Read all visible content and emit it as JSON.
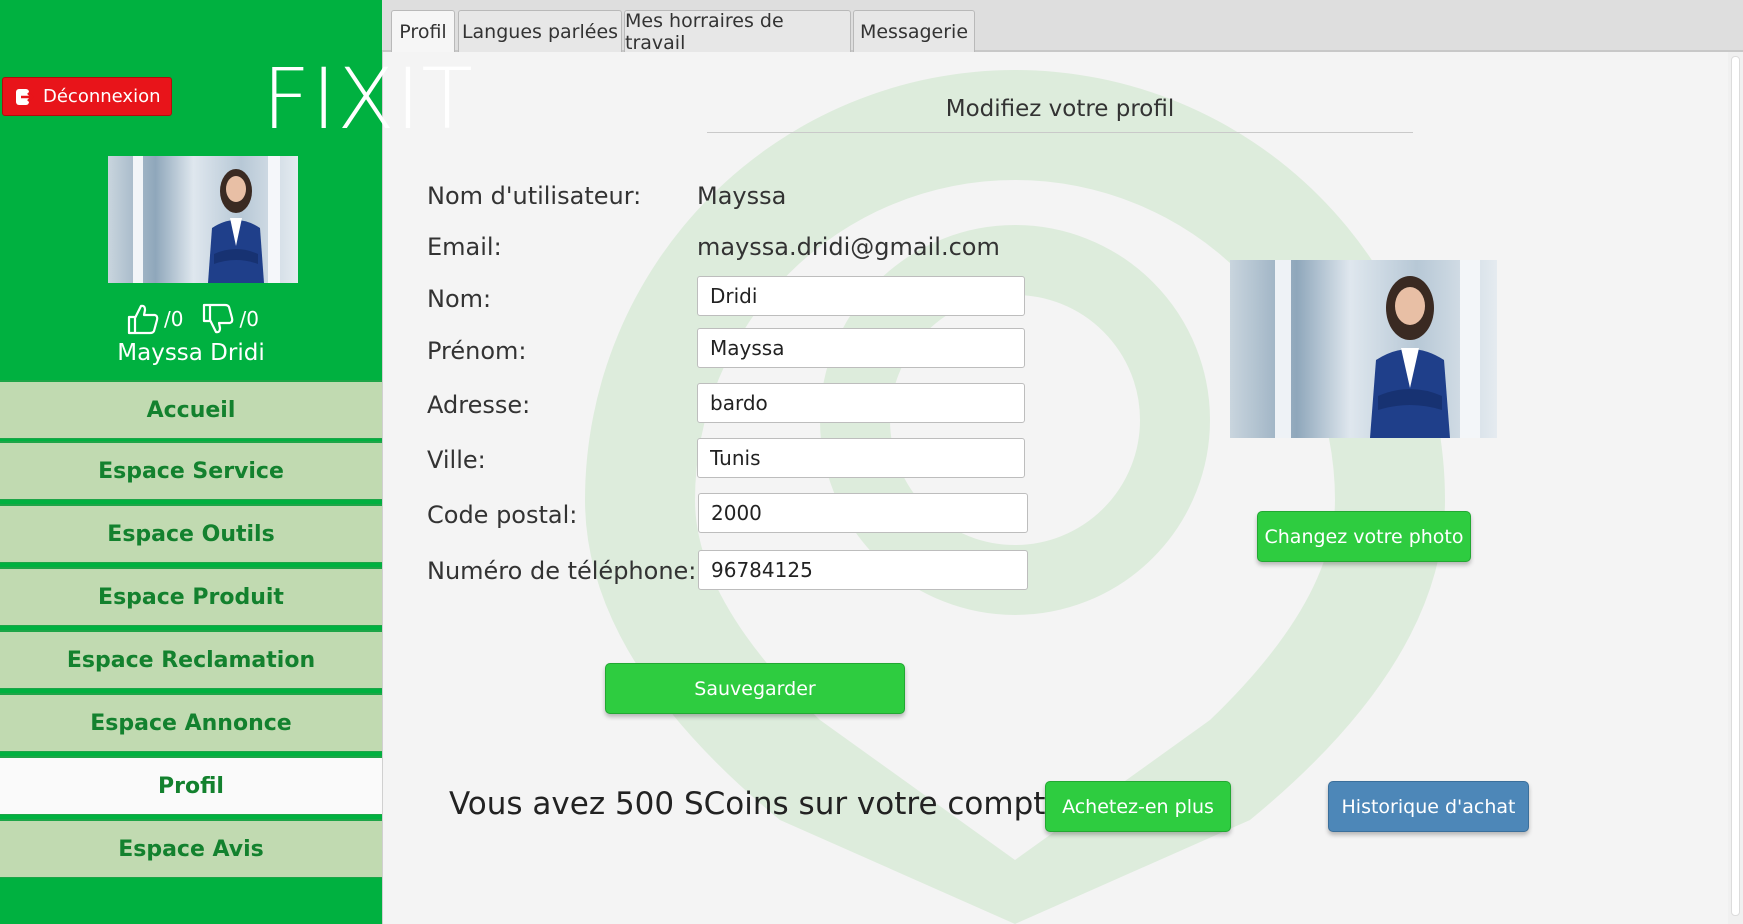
{
  "app": {
    "logo": "FIXIT",
    "accent": "#00b140",
    "logout_color": "#e8141a"
  },
  "sidebar": {
    "logout_label": "Déconnexion",
    "likes": "/0",
    "dislikes": "/0",
    "user_name": "Mayssa Dridi",
    "items": [
      {
        "label": "Accueil",
        "active": false
      },
      {
        "label": "Espace Service",
        "active": false
      },
      {
        "label": "Espace Outils",
        "active": false
      },
      {
        "label": "Espace Produit",
        "active": false
      },
      {
        "label": "Espace Reclamation",
        "active": false
      },
      {
        "label": "Espace Annonce",
        "active": false
      },
      {
        "label": "Profil",
        "active": true
      },
      {
        "label": "Espace Avis",
        "active": false
      }
    ]
  },
  "tabs": [
    {
      "label": "Profil",
      "active": true
    },
    {
      "label": "Langues parlées",
      "active": false
    },
    {
      "label": "Mes horraires de travail",
      "active": false
    },
    {
      "label": "Messagerie",
      "active": false
    }
  ],
  "form": {
    "title": "Modifiez votre profil",
    "username_label": "Nom d'utilisateur:",
    "username_value": "Mayssa",
    "email_label": "Email:",
    "email_value": "mayssa.dridi@gmail.com",
    "nom_label": "Nom:",
    "nom_value": "Dridi",
    "prenom_label": "Prénom:",
    "prenom_value": "Mayssa",
    "adresse_label": "Adresse:",
    "adresse_value": "bardo",
    "ville_label": "Ville:",
    "ville_value": "Tunis",
    "code_postal_label": "Code postal:",
    "code_postal_value": "2000",
    "telephone_label": "Numéro de téléphone:",
    "telephone_value": "96784125",
    "save_label": "Sauvegarder",
    "change_photo_label": "Changez votre photo"
  },
  "coins": {
    "text": "Vous avez 500 SCoins sur votre compte",
    "buy_label": "Achetez-en plus",
    "history_label": "Historique d'achat"
  }
}
